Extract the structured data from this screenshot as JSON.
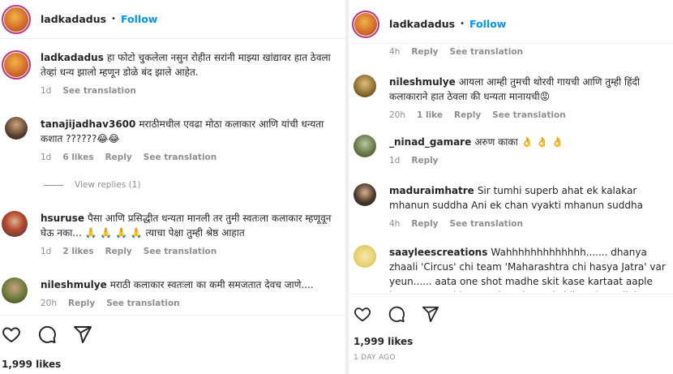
{
  "left": {
    "header": {
      "username": "ladkadadus",
      "dot": "•",
      "follow": "Follow"
    },
    "caption": {
      "username": "ladkadadus",
      "text": "हा फोटो चुकलेला नसुन रोहीत सरांनी माझ्या खांद्यावर हात ठेवला तेव्हां धन्य झालो म्हणून डोळे बंद झाले आहेत.",
      "time": "1d",
      "translate": "See translation"
    },
    "comments": [
      {
        "username": "tanajijadhav3600",
        "text": "मराठीमधील एवढा मोठा कलाकार आणि यांची धन्यता कशात ??????😂😂",
        "time": "1d",
        "likes": "6 likes",
        "reply": "Reply",
        "translate": "See translation"
      },
      {
        "username": "hsuruse",
        "text": "पैसा आणि प्रसिद्धीत धन्यता मानली तर तुमी स्वतःला कलाकार म्हणूवून घेऊ नका... 🙏 🙏 🙏 🙏 त्याचा पेक्षा तुम्ही श्रेष्ठ आहात",
        "time": "1d",
        "likes": "2 likes",
        "reply": "Reply",
        "translate": "See translation"
      },
      {
        "username": "nileshmulye",
        "text": "मराठी कलाकार स्वतःला का कमी समजतात देवच जाणे....",
        "time": "20h",
        "reply": "Reply",
        "translate": "See translation"
      }
    ],
    "view_replies": "View replies (1)",
    "likes": "1,999 likes"
  },
  "right": {
    "header": {
      "username": "ladkadadus",
      "dot": "•",
      "follow": "Follow"
    },
    "top_meta": {
      "time": "4h",
      "reply": "Reply",
      "translate": "See translation"
    },
    "comments": [
      {
        "username": "nileshmulye",
        "text": "आयला आम्ही तुमची थोरवी गायची आणि तुम्ही हिंदी कलाकाराने हात ठेवला की धन्यता मानायची😡",
        "time": "20h",
        "likes": "1 like",
        "reply": "Reply",
        "translate": "See translation"
      },
      {
        "username": "_ninad_gamare",
        "text": "अरुण काका 👌 👌 👌",
        "time": "1d",
        "reply": "Reply"
      },
      {
        "username": "maduraimhatre",
        "text": "Sir tumhi superb ahat ek kalakar mhanun suddha Ani ek chan vyakti mhanun suddha",
        "time": "4h",
        "reply": "Reply",
        "translate": "See translation"
      },
      {
        "username": "saayleescreations",
        "text": "Wahhhhhhhhhhhhh....... dhanya zhaali 'Circus' chi team 'Maharashtra chi hasya Jatra' var yeun...... aata one shot madhe skit kase kartaat aaple hasya atrangi hey naahaaylaa Ani shikaaylaa milel hyaanaa........ pratyek skit"
      }
    ],
    "likes": "1,999 likes",
    "ago": "1 DAY AGO"
  },
  "colors": {
    "accent": "#0095f6",
    "muted": "#8e8e8e",
    "text": "#262626"
  },
  "icons": [
    "heart-icon",
    "comment-icon",
    "share-icon"
  ]
}
